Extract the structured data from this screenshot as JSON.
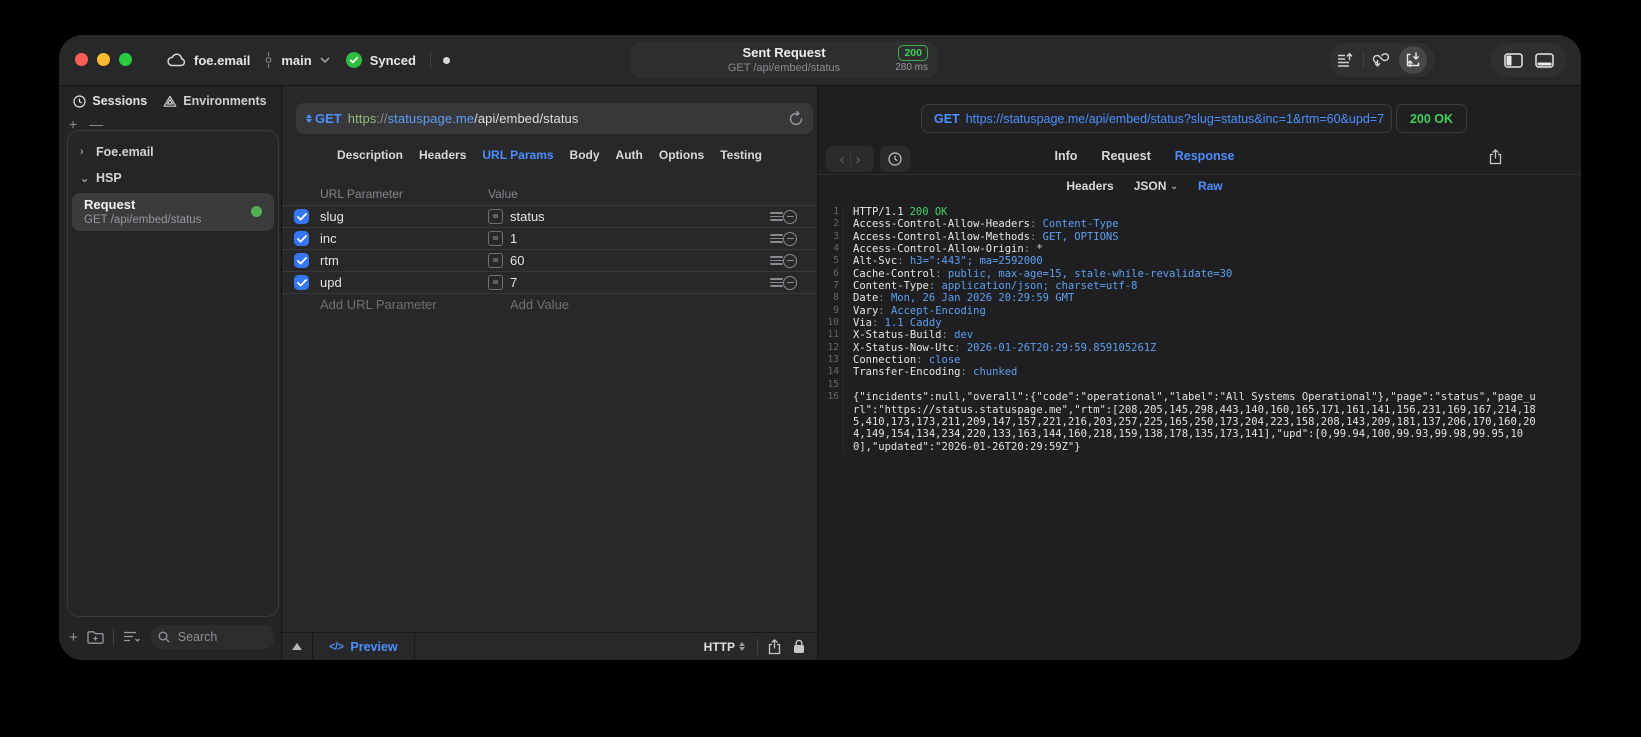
{
  "titlebar": {
    "project": "foe.email",
    "branch": "main",
    "sync": "Synced",
    "request_title": "Sent Request",
    "request_subtitle": "GET /api/embed/status",
    "status_code": "200",
    "duration": "280 ms"
  },
  "sidebar": {
    "tab_sessions": "Sessions",
    "tab_environments": "Environments",
    "group_collapsed": "Foe.email",
    "group_expanded": "HSP",
    "item_title": "Request",
    "item_subtitle": "GET /api/embed/status",
    "search_placeholder": "Search"
  },
  "request": {
    "method": "GET",
    "url_scheme": "https",
    "url_sep": "://",
    "url_host": "statuspage.me",
    "url_path": "/api/embed/status",
    "tabs": [
      "Description",
      "Headers",
      "URL Params",
      "Body",
      "Auth",
      "Options",
      "Testing"
    ],
    "table": {
      "col_param": "URL Parameter",
      "col_value": "Value",
      "eq": "=",
      "rows": [
        {
          "name": "slug",
          "value": "status"
        },
        {
          "name": "inc",
          "value": "1"
        },
        {
          "name": "rtm",
          "value": "60"
        },
        {
          "name": "upd",
          "value": "7"
        }
      ],
      "add_param": "Add URL Parameter",
      "add_value": "Add Value"
    },
    "footer": {
      "code_glyph": "</>",
      "preview": "Preview",
      "protocol": "HTTP"
    }
  },
  "response": {
    "request_line": "https://statuspage.me/api/embed/status?slug=status&inc=1&rtm=60&upd=7",
    "request_method": "GET",
    "status": "200 OK",
    "tab_info": "Info",
    "tab_request": "Request",
    "tab_response": "Response",
    "subtab_headers": "Headers",
    "subtab_json": "JSON",
    "subtab_raw": "Raw",
    "sep": ": ",
    "status_line": {
      "n": "1",
      "proto": "HTTP/1.1",
      "status": "200 OK"
    },
    "headers": [
      {
        "n": "2",
        "key": "Access-Control-Allow-Headers",
        "value": "Content-Type"
      },
      {
        "n": "3",
        "key": "Access-Control-Allow-Methods",
        "value": "GET, OPTIONS"
      },
      {
        "n": "4",
        "key": "Access-Control-Allow-Origin",
        "value": "*"
      },
      {
        "n": "5",
        "key": "Alt-Svc",
        "value": "h3=\":443\"; ma=2592000"
      },
      {
        "n": "6",
        "key": "Cache-Control",
        "value": "public, max-age=15, stale-while-revalidate=30"
      },
      {
        "n": "7",
        "key": "Content-Type",
        "value": "application/json; charset=utf-8"
      },
      {
        "n": "8",
        "key": "Date",
        "value": "Mon, 26 Jan 2026 20:29:59 GMT"
      },
      {
        "n": "9",
        "key": "Vary",
        "value": "Accept-Encoding"
      },
      {
        "n": "10",
        "key": "Via",
        "value": "1.1 Caddy"
      },
      {
        "n": "11",
        "key": "X-Status-Build",
        "value": "dev"
      },
      {
        "n": "12",
        "key": "X-Status-Now-Utc",
        "value": "2026-01-26T20:29:59.859105261Z"
      },
      {
        "n": "13",
        "key": "Connection",
        "value": "close"
      },
      {
        "n": "14",
        "key": "Transfer-Encoding",
        "value": "chunked"
      }
    ],
    "blank_line_n": "15",
    "body_line_n": "16",
    "body": "{\"incidents\":null,\"overall\":{\"code\":\"operational\",\"label\":\"All Systems Operational\"},\"page\":\"status\",\"page_url\":\"https://status.statuspage.me\",\"rtm\":[208,205,145,298,443,140,160,165,171,161,141,156,231,169,167,214,185,410,173,173,211,209,147,157,221,216,203,257,225,165,250,173,204,223,158,208,143,209,181,137,206,170,160,204,149,154,134,234,220,133,163,144,160,218,159,138,178,135,173,141],\"upd\":[0,99.94,100,99.93,99.98,99.95,100],\"updated\":\"2026-01-26T20:29:59Z\"}"
  }
}
